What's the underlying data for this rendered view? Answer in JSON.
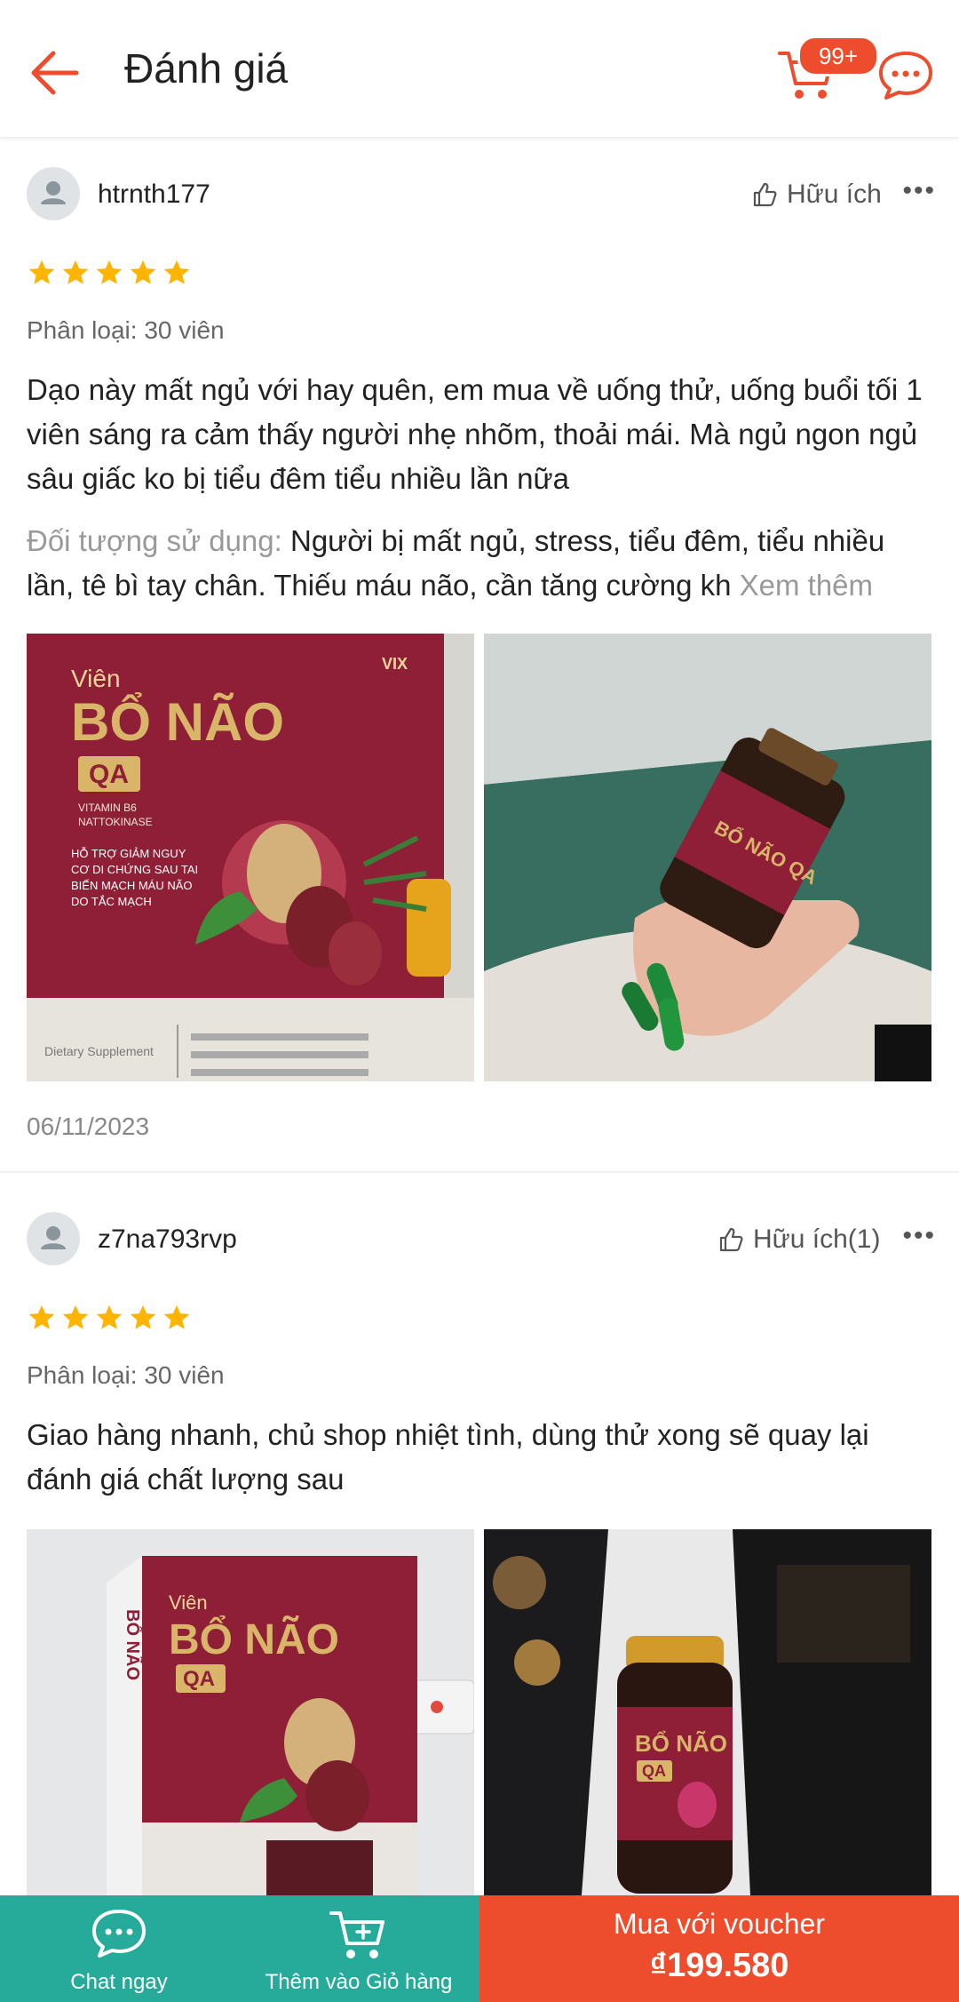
{
  "header": {
    "title": "Đánh giá",
    "cart_badge": "99+",
    "accent": "#ee4d2d"
  },
  "reviews": [
    {
      "username": "htrnth177",
      "helpful": "Hữu ích",
      "stars": 5,
      "variant": "Phân loại: 30 viên",
      "text": "Dạo này mất ngủ với hay quên, em mua về uống thử, uống buổi tối 1 viên sáng ra cảm thấy người nhẹ nhõm, thoải mái. Mà ngủ ngon ngủ sâu giấc ko bị tiểu đêm tiểu nhiều lần nữa",
      "usage_label": "Đối tượng sử dụng:",
      "usage_text": "Người bị mất ngủ, stress, tiểu đêm, tiểu nhiều lần, tê bì tay chân. Thiếu máu não, cần tăng cường kh",
      "see_more": "Xem thêm",
      "photos": [
        {
          "box_title_1": "Viên",
          "box_title_2": "BỔ NÃO",
          "box_title_3": "QA",
          "sub_1": "VITAMIN B6",
          "sub_2": "NATTOKINASE",
          "claim_1": "HỖ TRỢ GIẢM NGUY",
          "claim_2": "CƠ DI CHỨNG SAU TAI",
          "claim_3": "BIẾN MẠCH MÁU NÃO",
          "claim_4": "DO TẮC MẠCH",
          "footer": "Dietary Supplement",
          "brand": "VIX"
        },
        {
          "bottle_label": "BỔ NÃO QA"
        }
      ],
      "date": "06/11/2023"
    },
    {
      "username": "z7na793rvp",
      "helpful": "Hữu ích(1)",
      "stars": 5,
      "variant": "Phân loại: 30 viên",
      "text": "Giao hàng nhanh, chủ shop nhiệt tình, dùng thử xong sẽ quay lại đánh giá chất lượng sau",
      "photos": [
        {
          "box_title_1": "Viên",
          "box_title_2": "BỔ NÃO",
          "box_title_3": "QA"
        },
        {
          "bottle_title": "BỔ NÃO",
          "bottle_sub": "QA"
        }
      ]
    }
  ],
  "bottom_bar": {
    "chat_label": "Chat ngay",
    "cart_label": "Thêm vào Giỏ hàng",
    "buy_label": "Mua với voucher",
    "buy_price": "₫199.580",
    "teal": "#26aa99",
    "orange": "#ee4d2d"
  }
}
